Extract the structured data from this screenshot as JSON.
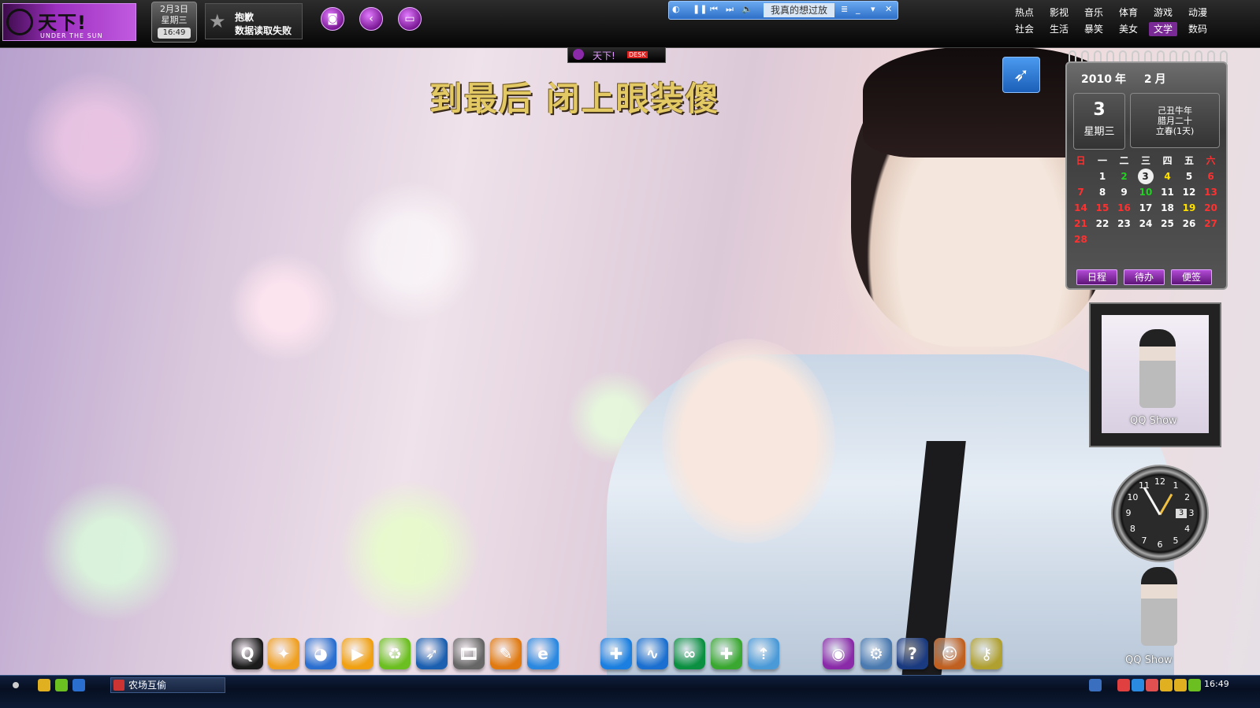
{
  "top_bar": {
    "logo": {
      "title": "天下!",
      "subtitle": "UNDER THE SUN"
    },
    "date_widget": {
      "date": "2月3日",
      "weekday": "星期三",
      "time": "16:49"
    },
    "notice": {
      "title": "抱歉",
      "message": "数据读取失败"
    },
    "tool_icons": [
      "camera-icon",
      "clock-arrow-icon",
      "tv-icon"
    ],
    "player": {
      "song": "我真的想过放"
    },
    "nav": {
      "row1": [
        "热点",
        "影视",
        "音乐",
        "体育",
        "游戏",
        "动漫"
      ],
      "row2": [
        "社会",
        "生活",
        "暴笑",
        "美女",
        "文学",
        "数码"
      ],
      "active": "文学"
    }
  },
  "desk_tab": {
    "name": "天下!",
    "badge": "DESK"
  },
  "slogan": "到最后  闭上眼装傻",
  "calendar": {
    "year": "2010",
    "year_unit": "年",
    "month": "2",
    "month_unit": "月",
    "day": "3",
    "weekday": "星期三",
    "lunar_lines": [
      "己丑牛年",
      "腊月二十",
      "立春(1天)"
    ],
    "week_headers": [
      "日",
      "一",
      "二",
      "三",
      "四",
      "五",
      "六"
    ],
    "weeks": [
      [
        "",
        "1",
        "2",
        "3",
        "4",
        "5",
        "6"
      ],
      [
        "7",
        "8",
        "9",
        "10",
        "11",
        "12",
        "13"
      ],
      [
        "14",
        "15",
        "16",
        "17",
        "18",
        "19",
        "20"
      ],
      [
        "21",
        "22",
        "23",
        "24",
        "25",
        "26",
        "27"
      ],
      [
        "28",
        "",
        "",
        "",
        "",
        "",
        ""
      ]
    ],
    "today": "3",
    "buttons": [
      "日程",
      "待办",
      "便签"
    ]
  },
  "qq_show": {
    "label": "QQ Show"
  },
  "clock": {
    "numbers": [
      "12",
      "1",
      "2",
      "3",
      "4",
      "5",
      "6",
      "7",
      "8",
      "9",
      "10",
      "11"
    ],
    "date_window": "3"
  },
  "dock": {
    "icons": [
      {
        "name": "qq-penguin-icon",
        "glyph": "Q",
        "color": "#1b1b1b"
      },
      {
        "name": "tencent-wings-icon",
        "glyph": "✦",
        "color": "#f0a020"
      },
      {
        "name": "qq-game-penguin-icon",
        "glyph": "◕",
        "color": "#2a6fd0"
      },
      {
        "name": "media-player-icon",
        "glyph": "▶",
        "color": "#f0a010"
      },
      {
        "name": "green-swirl-icon",
        "glyph": "♻",
        "color": "#6cbf20"
      },
      {
        "name": "feather-icon",
        "glyph": "➶",
        "color": "#1a5fb0"
      },
      {
        "name": "film-icon",
        "glyph": "🎞",
        "color": "#666666"
      },
      {
        "name": "video-editor-icon",
        "glyph": "✎",
        "color": "#e07a10"
      },
      {
        "name": "internet-explorer-icon",
        "glyph": "e",
        "color": "#2a88e0"
      },
      {
        "name": "security-shield-icon",
        "glyph": "✚",
        "color": "#1a7fe0"
      },
      {
        "name": "blue-wave-icon",
        "glyph": "∿",
        "color": "#1a6fd0"
      },
      {
        "name": "green-infinity-icon",
        "glyph": "∞",
        "color": "#0a9040"
      },
      {
        "name": "green-shield-icon",
        "glyph": "✚",
        "color": "#3aa830"
      },
      {
        "name": "recycle-arrows-icon",
        "glyph": "⇡",
        "color": "#4a9ad8"
      },
      {
        "name": "purple-logo-icon",
        "glyph": "◉",
        "color": "#8a2aa8"
      },
      {
        "name": "settings-gears-icon",
        "glyph": "⚙",
        "color": "#4a7ab0"
      },
      {
        "name": "help-icon",
        "glyph": "?",
        "color": "#1a3a80"
      },
      {
        "name": "users-icon",
        "glyph": "☺",
        "color": "#c06020"
      },
      {
        "name": "keys-icon",
        "glyph": "⚷",
        "color": "#b0a030"
      }
    ]
  },
  "taskbar": {
    "task": "农场互偷",
    "time": "16:49"
  }
}
